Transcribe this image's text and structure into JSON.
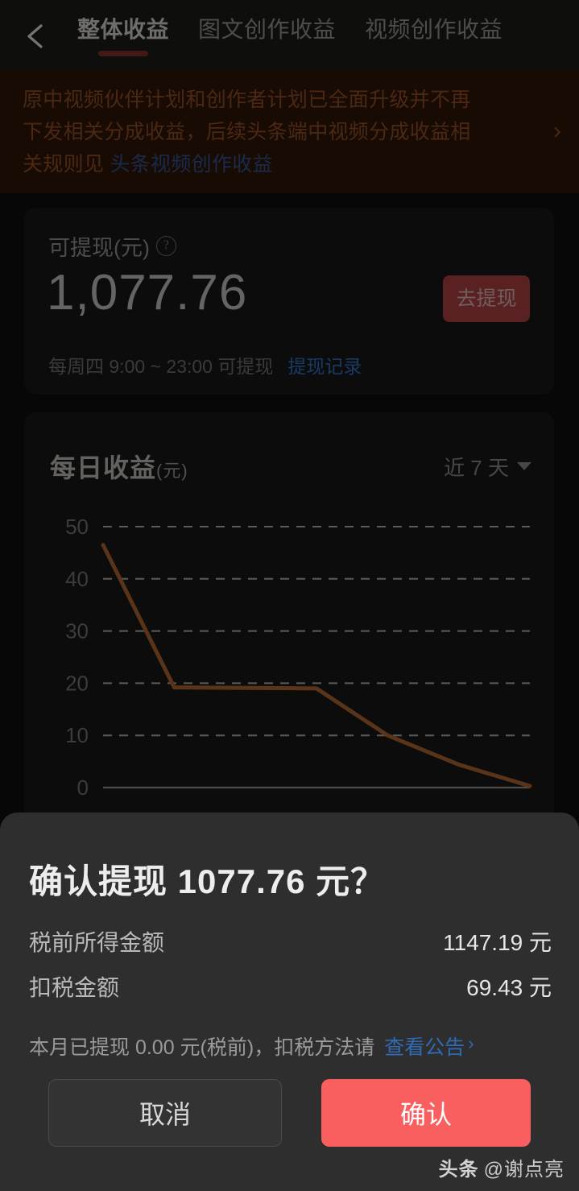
{
  "topbar": {
    "back_icon": "chevron-left-icon",
    "tabs": [
      {
        "label": "整体收益",
        "active": true
      },
      {
        "label": "图文创作收益",
        "active": false
      },
      {
        "label": "视频创作收益",
        "active": false
      }
    ]
  },
  "notice": {
    "line1": "原中视频伙伴计划和创作者计划已全面升级并不再",
    "line2": "下发相关分成收益，后续头条端中视频分成收益相",
    "line3_prefix": "关规则见 ",
    "link": "头条视频创作收益",
    "chevron": "›",
    "bg_color": "#2a1409",
    "text_color": "#8a4a22"
  },
  "balance": {
    "label": "可提现(元)",
    "help_icon": "question-mark-icon",
    "amount": "1,077.76",
    "withdraw_button": "去提现",
    "withdraw_button_color": "#a33c3f",
    "schedule": "每周四 9:00 ~ 23:00 可提现",
    "record_link": "提现记录",
    "link_color": "#2f6bb5"
  },
  "chart_card": {
    "title": "每日收益",
    "unit": "(元)",
    "range_label": "近 7 天",
    "range_caret": "chevron-down-icon"
  },
  "chart_data": {
    "type": "line",
    "title": "每日收益(元)",
    "xlabel": "",
    "ylabel": "元",
    "ylim": [
      0,
      50
    ],
    "yticks": [
      0,
      10,
      20,
      30,
      40,
      50
    ],
    "ytick_labels": [
      "0",
      "10",
      "20",
      "30",
      "40",
      "50"
    ],
    "grid": true,
    "grid_style": "dashed",
    "legend": "none",
    "x": [
      1,
      2,
      3,
      4,
      5,
      6,
      7
    ],
    "values": [
      46.5,
      19.2,
      19.1,
      19.0,
      10.0,
      4.4,
      0.3
    ],
    "line_color": "#a2602f",
    "axis_color": "#8a8a8a",
    "tick_color": "#6f6d6b"
  },
  "modal": {
    "title": "确认提现 1077.76 元？",
    "rows": [
      {
        "key": "税前所得金额",
        "value": "1147.19 元"
      },
      {
        "key": "扣税金额",
        "value": "69.43 元"
      }
    ],
    "note_text": "本月已提现 0.00 元(税前)，扣税方法请",
    "note_link": "查看公告",
    "note_chevron": "›",
    "cancel_label": "取消",
    "confirm_label": "确认",
    "confirm_color": "#fa5f5f",
    "sheet_bg": "#2e2e2e"
  },
  "watermark": {
    "brand": "头条",
    "handle": "@谢点亮"
  }
}
